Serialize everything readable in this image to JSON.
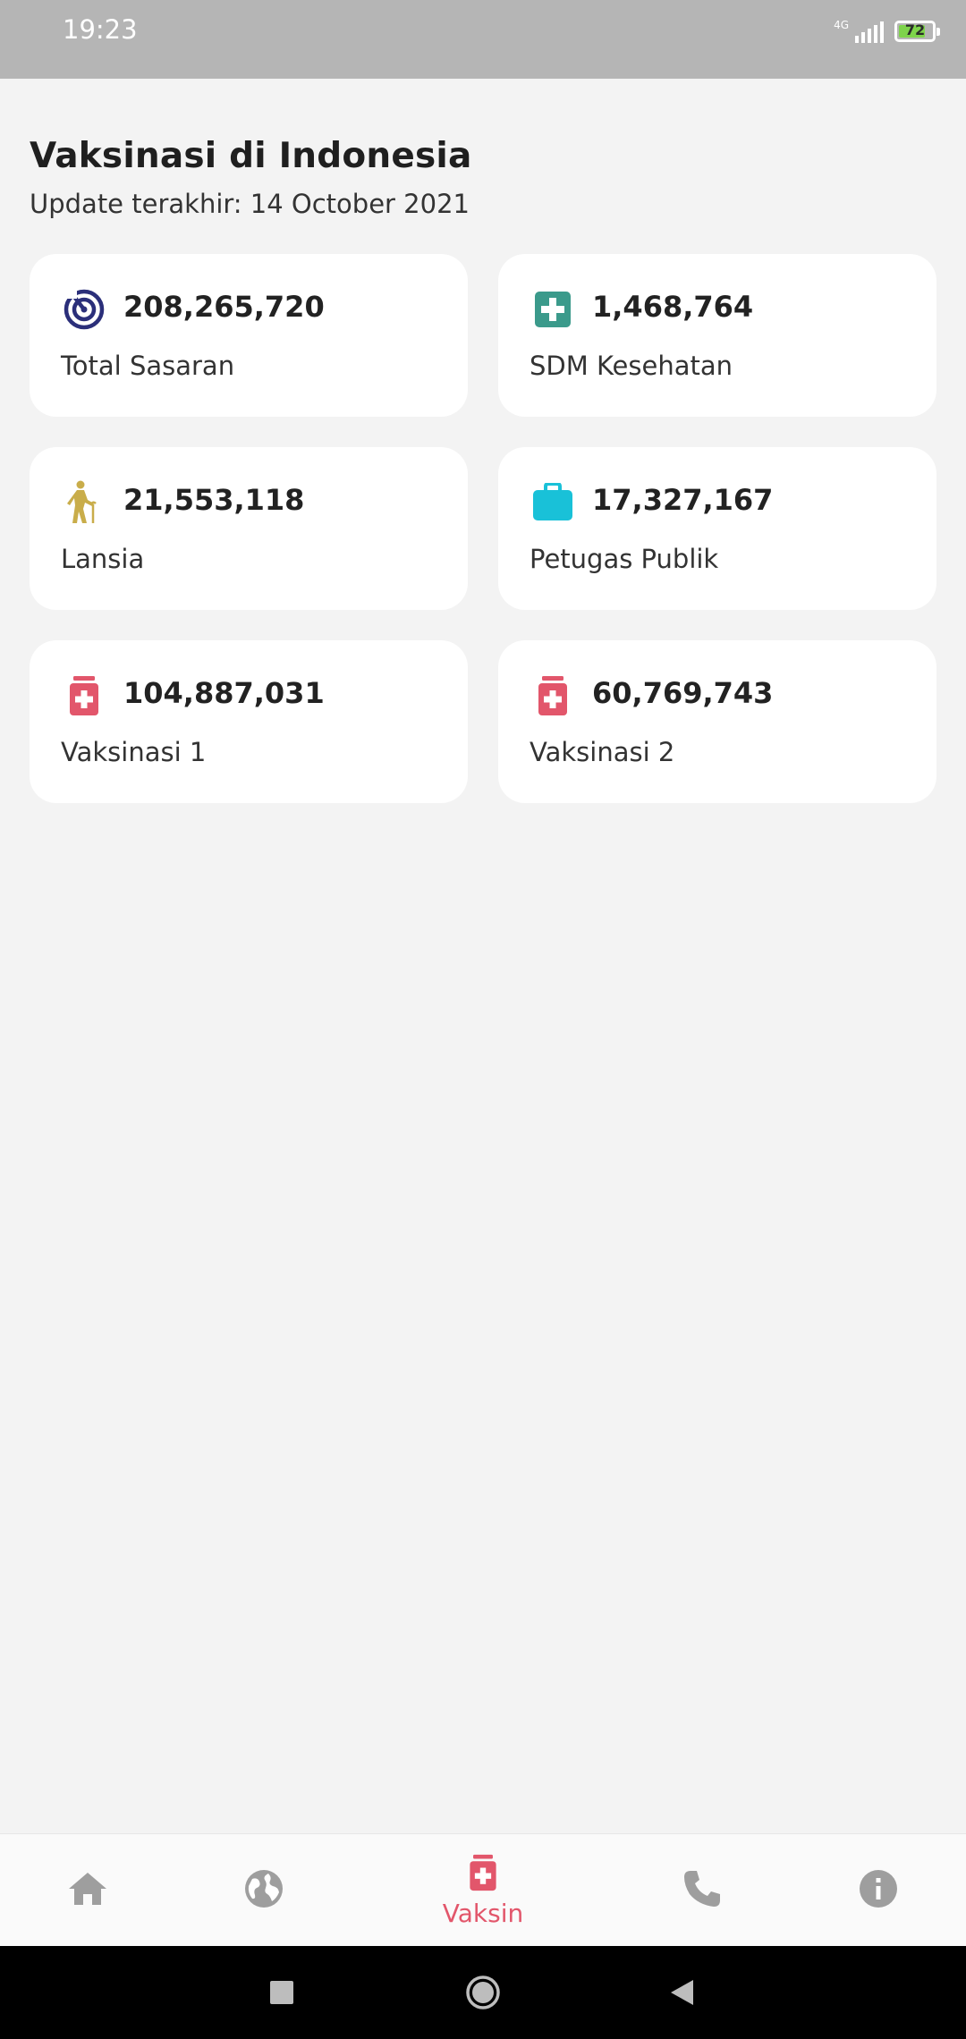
{
  "status_bar": {
    "time": "19:23",
    "network": "4G",
    "battery": "72"
  },
  "header": {
    "title": "Vaksinasi di Indonesia",
    "subtitle": "Update terakhir: 14 October 2021"
  },
  "cards": [
    {
      "value": "208,265,720",
      "label": "Total Sasaran",
      "icon": "target-icon",
      "color": "#2b2f7a"
    },
    {
      "value": "1,468,764",
      "label": "SDM Kesehatan",
      "icon": "medical-cross-icon",
      "color": "#3b9a8b"
    },
    {
      "value": "21,553,118",
      "label": "Lansia",
      "icon": "elderly-person-icon",
      "color": "#c9ad4a"
    },
    {
      "value": "17,327,167",
      "label": "Petugas Publik",
      "icon": "briefcase-icon",
      "color": "#19c1d8"
    },
    {
      "value": "104,887,031",
      "label": "Vaksinasi 1",
      "icon": "vaccine-bottle-icon",
      "color": "#e2566b"
    },
    {
      "value": "60,769,743",
      "label": "Vaksinasi 2",
      "icon": "vaccine-bottle-icon",
      "color": "#e2566b"
    }
  ],
  "bottom_nav": {
    "active_label": "Vaksin",
    "items": [
      "home-icon",
      "globe-icon",
      "vaccine-bottle-icon",
      "phone-icon",
      "info-icon"
    ]
  },
  "colors": {
    "accent": "#e2566b",
    "inactive": "#9e9e9e",
    "background": "#f3f3f3"
  }
}
